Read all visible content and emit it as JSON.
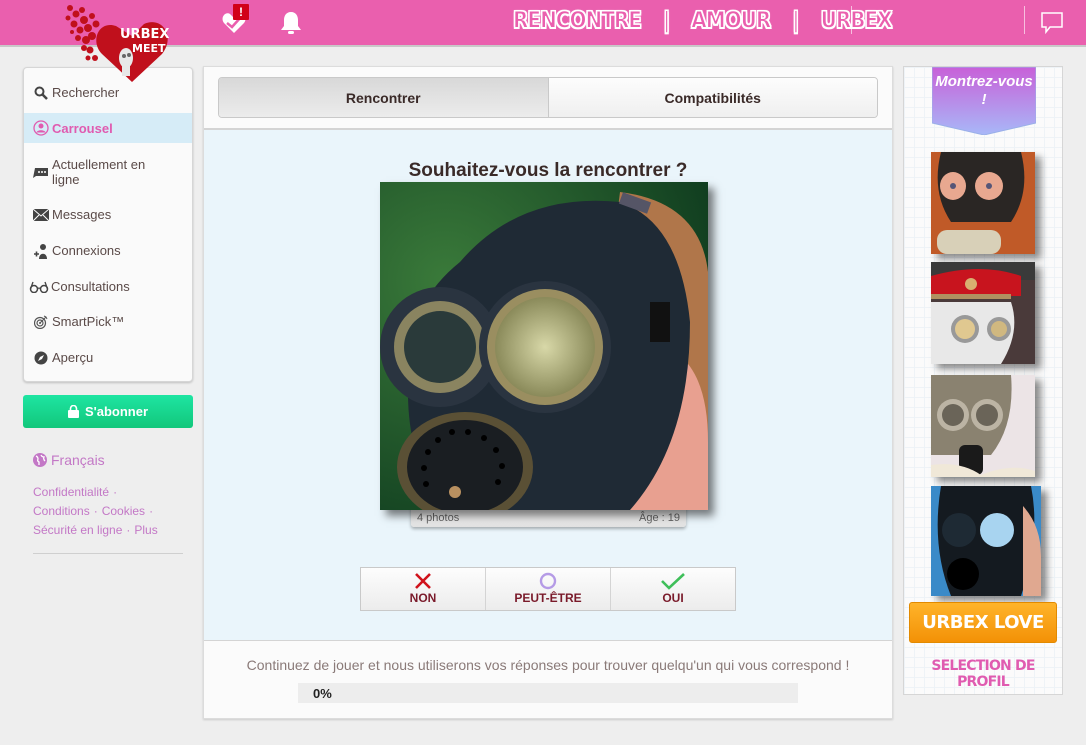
{
  "header": {
    "logo_text_line1": "URBEX",
    "logo_text_line2": "MEET",
    "notification_badge": "!",
    "slogan": [
      "RENCONTRE",
      "|",
      "AMOUR",
      "|",
      "URBEX"
    ],
    "icons": [
      "match-alert-icon",
      "bell-icon",
      "chat-icon"
    ],
    "brand_color": "#ea5fae"
  },
  "sidebar": {
    "items": [
      {
        "label": "Rechercher",
        "icon": "search-icon",
        "active": false
      },
      {
        "label": "Carrousel",
        "icon": "carousel-user-icon",
        "active": true
      },
      {
        "label": "Actuellement en ligne",
        "icon": "online-chat-icon",
        "active": false
      },
      {
        "label": "Messages",
        "icon": "envelope-icon",
        "active": false
      },
      {
        "label": "Connexions",
        "icon": "add-user-icon",
        "active": false
      },
      {
        "label": "Consultations",
        "icon": "glasses-icon",
        "active": false
      },
      {
        "label": "SmartPick™",
        "icon": "target-icon",
        "active": false
      },
      {
        "label": "Aperçu",
        "icon": "compass-icon",
        "active": false
      }
    ],
    "subscribe_label": "S'abonner",
    "language": "Français",
    "footer_links": [
      "Confidentialité",
      "Conditions",
      "Cookies",
      "Sécurité en ligne",
      "Plus"
    ],
    "footer_separator": "·"
  },
  "main": {
    "tabs": [
      {
        "label": "Rencontrer",
        "active": true
      },
      {
        "label": "Compatibilités",
        "active": false
      }
    ],
    "question": "Souhaitez-vous la rencontrer ?",
    "profile": {
      "photo_count": "4 photos",
      "age_label": "Âge : 19"
    },
    "choices": [
      {
        "label": "NON",
        "icon": "x-icon",
        "color": "#d0121b"
      },
      {
        "label": "PEUT-ÊTRE",
        "icon": "circle-icon",
        "color": "#b59be6"
      },
      {
        "label": "OUI",
        "icon": "check-icon",
        "color": "#3fbf5a"
      }
    ],
    "progress_message": "Continuez de jouer et nous utiliserons vos réponses pour trouver quelqu'un qui vous correspond !",
    "progress_percent": 0,
    "progress_label": "0%"
  },
  "right_panel": {
    "banner": "Montrez-vous !",
    "thumbnails": [
      "profile-thumb-1",
      "profile-thumb-2",
      "profile-thumb-3",
      "profile-thumb-4"
    ],
    "cta_label": "URBEX LOVE",
    "selection_label": "SELECTION DE PROFIL"
  }
}
